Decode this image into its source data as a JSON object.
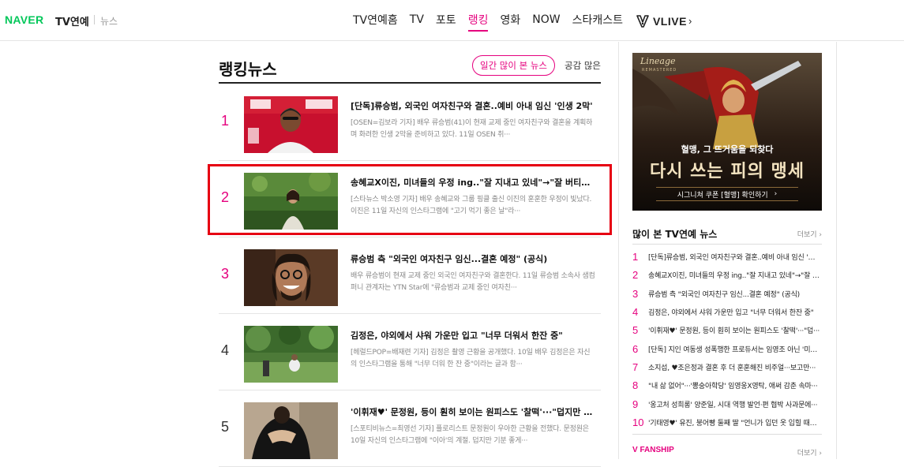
{
  "header": {
    "logo": "NAVER",
    "service": "TV연예",
    "sub": "뉴스",
    "menu": [
      {
        "label": "TV연예홈",
        "active": false
      },
      {
        "label": "TV",
        "active": false
      },
      {
        "label": "포토",
        "active": false
      },
      {
        "label": "랭킹",
        "active": true
      },
      {
        "label": "영화",
        "active": false
      },
      {
        "label": "NOW",
        "active": false
      },
      {
        "label": "스타캐스트",
        "active": false
      }
    ],
    "vlive": "VLIVE",
    "vlive_arrow": "›"
  },
  "main": {
    "title": "랭킹뉴스",
    "tab_active": "일간 많이 본 뉴스",
    "tab_inactive": "공감 많은",
    "items": [
      {
        "rank": "1",
        "title": "[단독]류승범, 외국인 여자친구와 결혼..예비 아내 임신 '인생 2막'",
        "desc": "[OSEN=김보라 기자] 배우 류승범(41)이 현재 교제 중인 여자친구와 결혼을 계획하며 화려한 인생 2막을 준비하고 있다. 11일 OSEN 취···"
      },
      {
        "rank": "2",
        "title": "송혜교X이진, 미녀들의 우정 ing..\"잘 지내고 있네\"→\"잘 버티고 있어\"",
        "desc": "[스타뉴스 박소영 기자] 배우 송혜교와 그룹 핑클 출신 이진의 훈훈한 우정이 빛났다. 이진은 11일 자신의 인스타그램에 \"고기 먹기 좋은 날\"라···"
      },
      {
        "rank": "3",
        "title": "류승범 측 \"외국인 여자친구 임신...결혼 예정\" (공식)",
        "desc": "배우 류승범이 현재 교제 중인 외국인 여자친구와 결혼한다. 11일 류승범 소속사 샘컴퍼니 관계자는 YTN Star에 \"류승범과 교제 중인 여자친···"
      },
      {
        "rank": "4",
        "title": "김정은, 야외에서 샤워 가운만 입고 \"너무 더워서 한잔 중\"",
        "desc": "[헤럴드POP=배재련 기자] 김정은 촬영 근황을 공개했다. 10일 배우 김정은은 자신의 인스타그램을 통해 \"너무 더워 한 잔 중\"이라는 글과 함···"
      },
      {
        "rank": "5",
        "title": "'이휘재♥' 문정원, 등이 훤히 보이는 원피스도 '찰떡'···\"덥지만 기분···",
        "desc": "[스포티비뉴스=최영선 기자] 플로리스트 문정원이 우아한 근황을 전했다. 문정원은 10일 자신의 인스타그램에 \"이아'의 계절. 덥지만 기분 좋게···"
      }
    ]
  },
  "ad": {
    "brand": "Lineage",
    "brand_sub": "REMASTERED",
    "line1": "혈맹, 그 뜨거움을 되찾다",
    "line2": "다시 쓰는 피의 맹세",
    "cta": "시그니쳐 쿠폰 [혈맹] 확인하기",
    "cta_arrow": "›"
  },
  "popular": {
    "title": "많이 본 TV연예 뉴스",
    "more": "더보기 ›",
    "items": [
      {
        "rank": "1",
        "text": "[단독]류승범, 외국인 여자친구와 결혼..예비 아내 임신 '인···"
      },
      {
        "rank": "2",
        "text": "송혜교X이진, 미녀들의 우정 ing..\"잘 지내고 있네\"→\"잘 버···"
      },
      {
        "rank": "3",
        "text": "류승범 측 \"외국인 여자친구 임신...결혼 예정\" (공식)"
      },
      {
        "rank": "4",
        "text": "김정은, 야외에서 샤워 가운만 입고 \"너무 더워서 한잔 중\""
      },
      {
        "rank": "5",
        "text": "'이휘재♥' 문정원, 등이 훤히 보이는 원피스도 '찰떡'···\"덥···"
      },
      {
        "rank": "6",
        "text": "[단독] 지인 여동생 성폭행한 프로듀서는 임영조 아닌 '미스···"
      },
      {
        "rank": "7",
        "text": "소지섭, ♥조은정과 결혼 후 더 훈훈해진 비주얼···보고만···"
      },
      {
        "rank": "8",
        "text": "\"내 삶 없어\"···'뽕숭아학당' 임영웅X영탁, 애써 감춘 속마···"
      },
      {
        "rank": "9",
        "text": "'옹고처 성희롱' 양준일, 시대 역행 발언·편 협박 사과문에···"
      },
      {
        "rank": "10",
        "text": "'기태영♥' 유진, 붕어빵 둘째 딸 \"언니가 입던 옷 입힐 때마···"
      }
    ]
  },
  "vfanship": {
    "title": "V FANSHIP",
    "more": "더보기 ›"
  },
  "colors": {
    "accent": "#e5007e",
    "naver_green": "#03c75a",
    "highlight_border": "#e60012"
  }
}
